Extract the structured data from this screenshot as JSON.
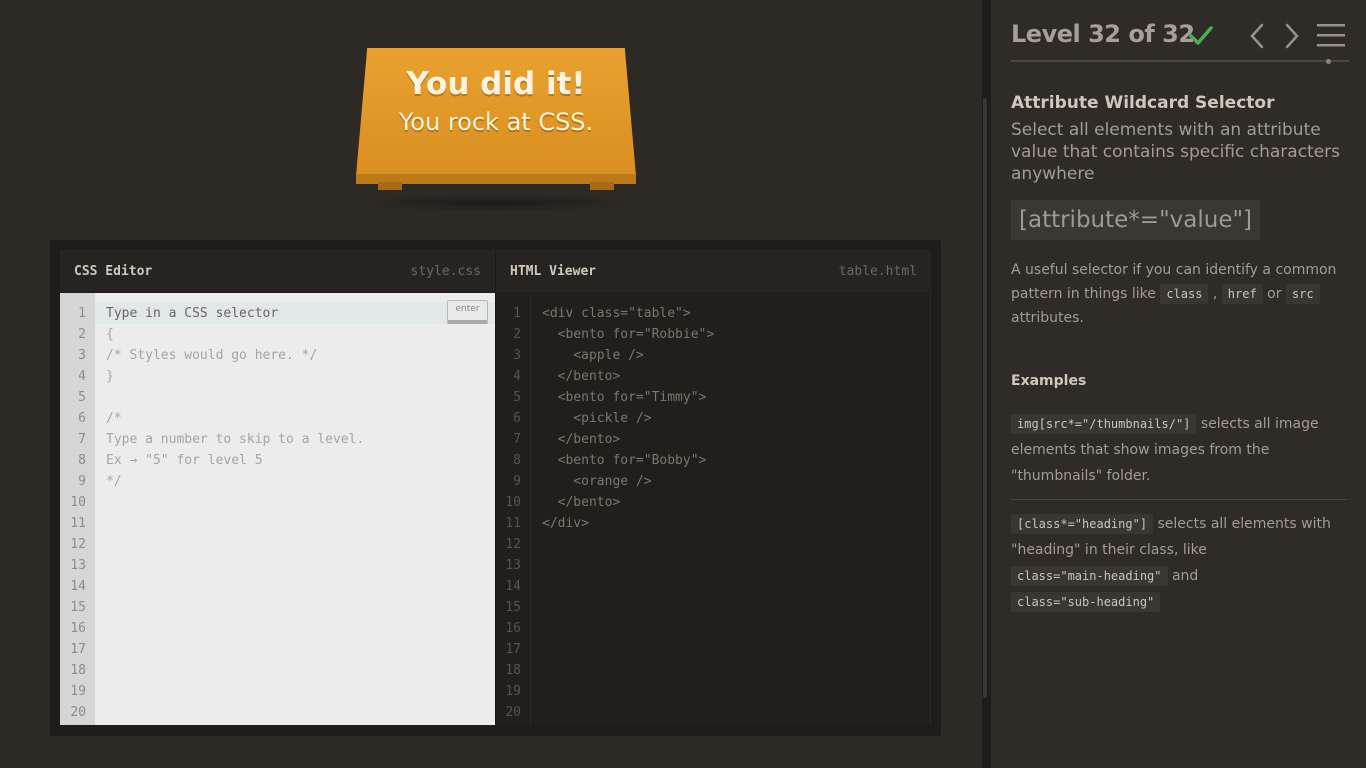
{
  "win": {
    "line1": "You did it!",
    "line2": "You rock at CSS."
  },
  "css_editor": {
    "title": "CSS Editor",
    "file": "style.css",
    "input_placeholder": "Type in a CSS selector",
    "enter_label": "enter",
    "line_numbers": [
      "1",
      "2",
      "3",
      "4",
      "5",
      "6",
      "7",
      "8",
      "9",
      "10",
      "11",
      "12",
      "13",
      "14",
      "15",
      "16",
      "17",
      "18",
      "19",
      "20"
    ],
    "lines": [
      "{",
      "/* Styles would go here. */",
      "}",
      "",
      "/*",
      "Type a number to skip to a level.",
      "Ex → \"5\" for level 5",
      "*/"
    ]
  },
  "html_viewer": {
    "title": "HTML Viewer",
    "file": "table.html",
    "line_numbers": [
      "1",
      "2",
      "3",
      "4",
      "5",
      "6",
      "7",
      "8",
      "9",
      "10",
      "11",
      "12",
      "13",
      "14",
      "15",
      "16",
      "17",
      "18",
      "19",
      "20"
    ],
    "lines": [
      "<div class=\"table\">",
      "  <bento for=\"Robbie\">",
      "    <apple />",
      "  </bento>",
      "  <bento for=\"Timmy\">",
      "    <pickle />",
      "  </bento>",
      "  <bento for=\"Bobby\">",
      "    <orange />",
      "  </bento>",
      "</div>"
    ]
  },
  "sidebar": {
    "level_title": "Level 32 of 32",
    "check_icon": "checkmark-icon",
    "check_color": "#4caf50",
    "selector_name": "Attribute Wildcard Selector",
    "description": "Select all elements with an attribute value that contains specific characters anywhere",
    "syntax": "[attribute*=\"value\"]",
    "hint": {
      "part1": "A useful selector if you can identify a common pattern in things like ",
      "tag1": "class",
      "sep1": " , ",
      "tag2": "href",
      "sep2": " or ",
      "tag3": "src",
      "part2": " attributes."
    },
    "examples_title": "Examples",
    "example1": {
      "code": "img[src*=\"/thumbnails/\"]",
      "text": " selects all image elements that show images from the \"thumbnails\" folder."
    },
    "example2": {
      "code": "[class*=\"heading\"]",
      "text1": " selects all elements with \"heading\" in their class, like ",
      "code2": "class=\"main-heading\"",
      "text2": " and ",
      "code3": "class=\"sub-heading\""
    }
  }
}
